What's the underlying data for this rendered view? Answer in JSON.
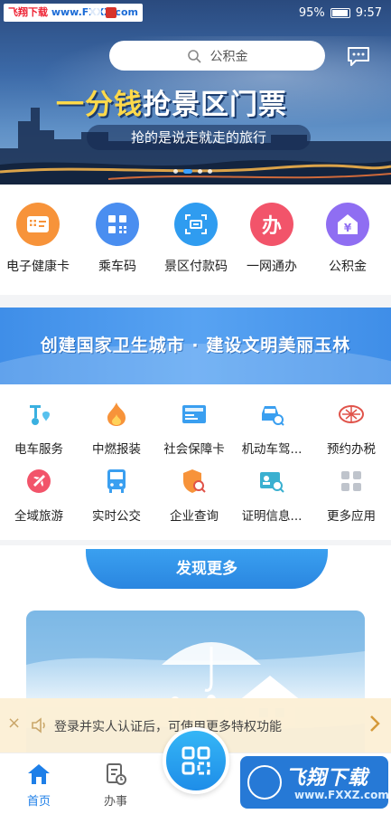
{
  "status_bar": {
    "watermark": "飞翔下载 www.FXXZ.com",
    "watermark_brand": "飞翔下载",
    "watermark_url": "www.FXXZ.com",
    "battery": "95%",
    "time": "9:57"
  },
  "header": {
    "search_placeholder": "公积金",
    "message_icon": "chat-bubble-icon"
  },
  "hero": {
    "title_part1": "一分钱",
    "title_part2": "抢景区门票",
    "subtitle": "抢的是说走就走的旅行",
    "carousel_count": 4,
    "carousel_active": 1
  },
  "quick_services": [
    {
      "label": "电子健康卡",
      "icon": "health-card-icon",
      "color": "#f7933a"
    },
    {
      "label": "乘车码",
      "icon": "qr-code-icon",
      "color": "#4a8ef0"
    },
    {
      "label": "景区付款码",
      "icon": "scan-pay-icon",
      "color": "#2f9cf0"
    },
    {
      "label": "一网通办",
      "icon": "ban-icon",
      "color": "#f2546a"
    },
    {
      "label": "公积金",
      "icon": "fund-house-icon",
      "color": "#8f6ef2"
    }
  ],
  "banner": {
    "text": "创建国家卫生城市 · 建设文明美丽玉林"
  },
  "services": [
    {
      "label": "电车服务",
      "icon": "ebike-icon"
    },
    {
      "label": "中燃报装",
      "icon": "gas-flame-icon"
    },
    {
      "label": "社会保障卡",
      "icon": "social-security-card-icon"
    },
    {
      "label": "机动车驾...",
      "icon": "car-search-icon"
    },
    {
      "label": "预约办税",
      "icon": "tax-emblem-icon"
    },
    {
      "label": "全域旅游",
      "icon": "airplane-icon"
    },
    {
      "label": "实时公交",
      "icon": "bus-icon"
    },
    {
      "label": "企业查询",
      "icon": "enterprise-search-icon"
    },
    {
      "label": "证明信息...",
      "icon": "certificate-search-icon"
    },
    {
      "label": "更多应用",
      "icon": "more-apps-icon"
    }
  ],
  "discover": {
    "title": "发现更多"
  },
  "login_tip": {
    "text": "登录并实人认证后，可使用更多特权功能"
  },
  "tabbar": {
    "home": "首页",
    "tasks": "办事",
    "center_icon": "scan-grid-icon"
  },
  "bottom_watermark": {
    "brand": "飞翔下载",
    "url": "www.FXXZ.com"
  },
  "colors": {
    "accent": "#1e7fe8",
    "banner": "#4a97ec",
    "tip_bg": "#fcf0d6"
  }
}
